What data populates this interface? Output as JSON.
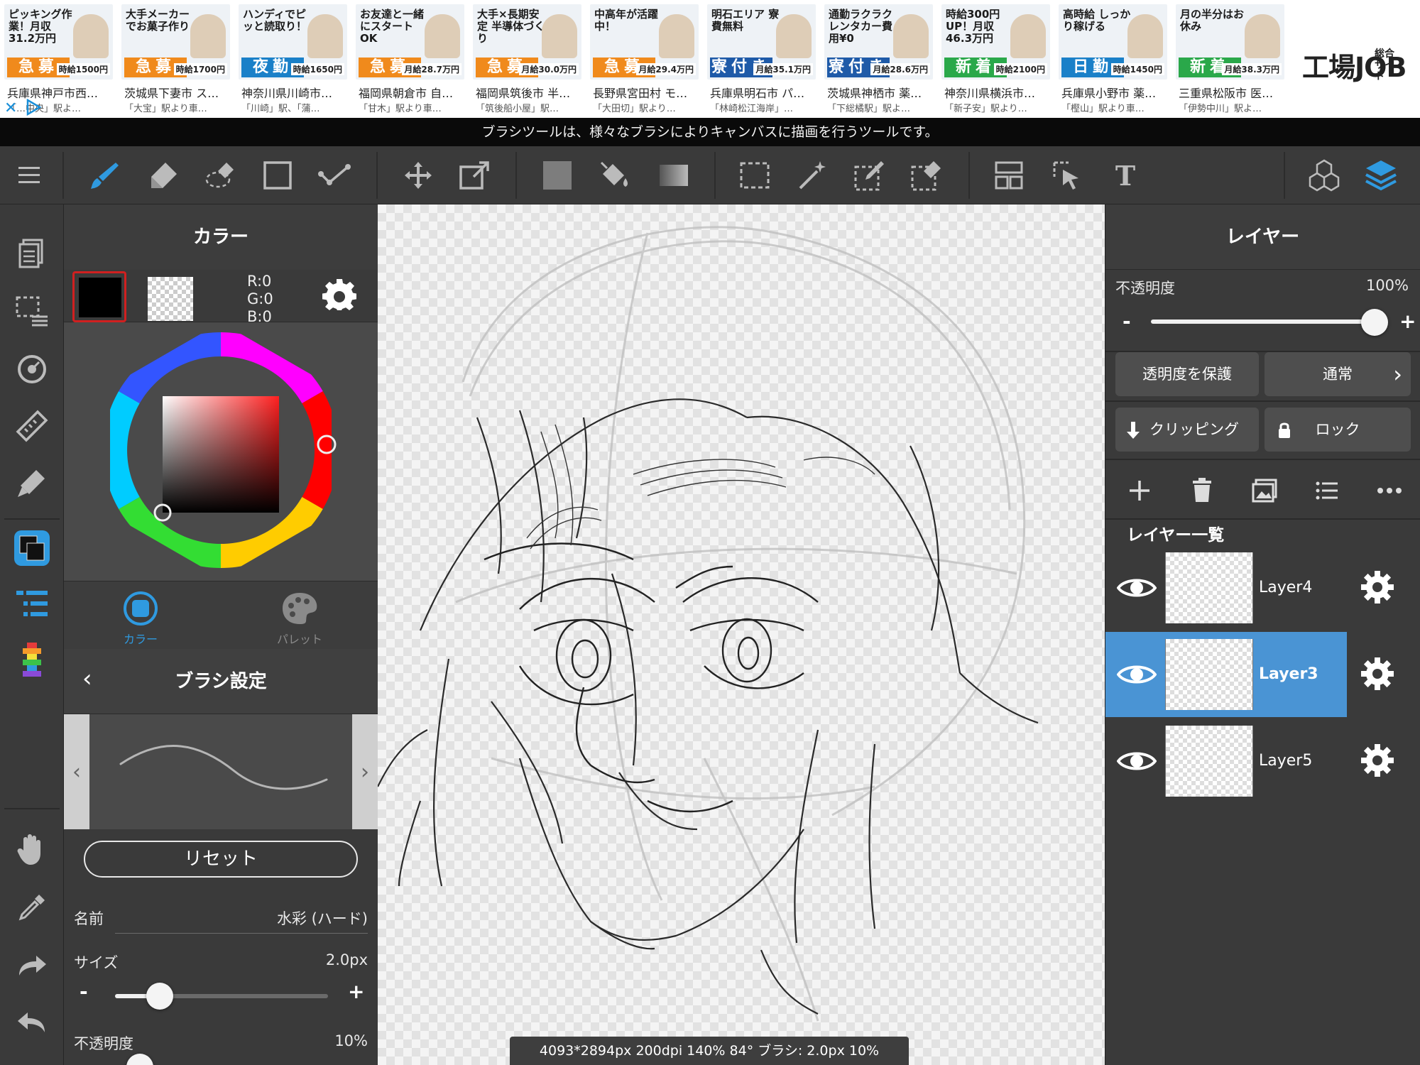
{
  "ads": [
    {
      "headline": "ピッキング作業！月収31.2万円",
      "badge": "急募",
      "badge_color": "#f08a1c",
      "wage": "時給1500円",
      "location": "兵庫県神戸市西…",
      "station": "「…中央」駅よ…"
    },
    {
      "headline": "大手メーカーでお菓子作り",
      "badge": "急募",
      "badge_color": "#f08a1c",
      "wage": "時給1700円",
      "location": "茨城県下妻市 ス…",
      "station": "「大宝」駅より車…"
    },
    {
      "headline": "ハンディでピッと読取り！",
      "badge": "夜勤",
      "badge_color": "#1a80c8",
      "wage": "時給1650円",
      "location": "神奈川県川崎市…",
      "station": "「川崎」駅、「蒲…"
    },
    {
      "headline": "お友達と一緒にスタートOK",
      "badge": "急募",
      "badge_color": "#f08a1c",
      "wage": "月給28.7万円",
      "location": "福岡県朝倉市 自…",
      "station": "「甘木」駅より車…"
    },
    {
      "headline": "大手×長期安定 半導体づくり",
      "badge": "急募",
      "badge_color": "#f08a1c",
      "wage": "月給30.0万円",
      "location": "福岡県筑後市 半…",
      "station": "「筑後船小屋」駅…"
    },
    {
      "headline": "中高年が活躍中！",
      "badge": "急募",
      "badge_color": "#f08a1c",
      "wage": "月給29.4万円",
      "location": "長野県宮田村 モ…",
      "station": "「大田切」駅より…"
    },
    {
      "headline": "明石エリア 寮費無料",
      "badge": "寮付き",
      "badge_color": "#1e5aa8",
      "wage": "月給35.1万円",
      "location": "兵庫県明石市 パ…",
      "station": "「林崎松江海岸」…"
    },
    {
      "headline": "通勤ラクラク レンタカー費用¥0",
      "badge": "寮付き",
      "badge_color": "#1e5aa8",
      "wage": "月給28.6万円",
      "location": "茨城県神栖市 薬…",
      "station": "「下総橘駅」駅よ…"
    },
    {
      "headline": "時給300円UP！月収46.3万円",
      "badge": "新着",
      "badge_color": "#2aa84a",
      "wage": "時給2100円",
      "location": "神奈川県横浜市…",
      "station": "「新子安」駅より…"
    },
    {
      "headline": "高時給 しっかり稼げる",
      "badge": "日勤",
      "badge_color": "#1a80c8",
      "wage": "時給1450円",
      "location": "兵庫県小野市 薬…",
      "station": "「樫山」駅より車…"
    },
    {
      "headline": "月の半分はお休み",
      "badge": "新着",
      "badge_color": "#2aa84a",
      "wage": "月給38.3万円",
      "location": "三重県松阪市 医…",
      "station": "「伊勢中川」駅よ…"
    }
  ],
  "ad_logo": {
    "main": "工場JOB",
    "sub": "総合サイト"
  },
  "hint": "ブラシツールは、様々なブラシによりキャンバスに描画を行うツールです。",
  "color_panel": {
    "title": "カラー",
    "r": "R:0",
    "g": "G:0",
    "b": "B:0",
    "tab_color": "カラー",
    "tab_palette": "パレット",
    "accent": "#2f9ae0"
  },
  "brush_panel": {
    "title": "ブラシ設定",
    "reset": "リセット",
    "name_label": "名前",
    "name_value": "水彩 (ハード)",
    "size_label": "サイズ",
    "size_value": "2.0px",
    "size_fraction": 0.21,
    "opacity_label": "不透明度",
    "opacity_value": "10%",
    "minus": "-",
    "plus": "+"
  },
  "status": "4093*2894px 200dpi 140% 84° ブラシ: 2.0px 10%",
  "layer_panel": {
    "title": "レイヤー",
    "opacity_label": "不透明度",
    "opacity_value": "100%",
    "opacity_fraction": 1.0,
    "minus": "-",
    "plus": "+",
    "protect_alpha": "透明度を保護",
    "blend_mode": "通常",
    "clipping": "クリッピング",
    "lock": "ロック",
    "list_title": "レイヤー一覧",
    "layers": [
      {
        "name": "Layer4",
        "selected": false
      },
      {
        "name": "Layer3",
        "selected": true
      },
      {
        "name": "Layer5",
        "selected": false
      }
    ],
    "selected_color": "#4a94d4"
  }
}
